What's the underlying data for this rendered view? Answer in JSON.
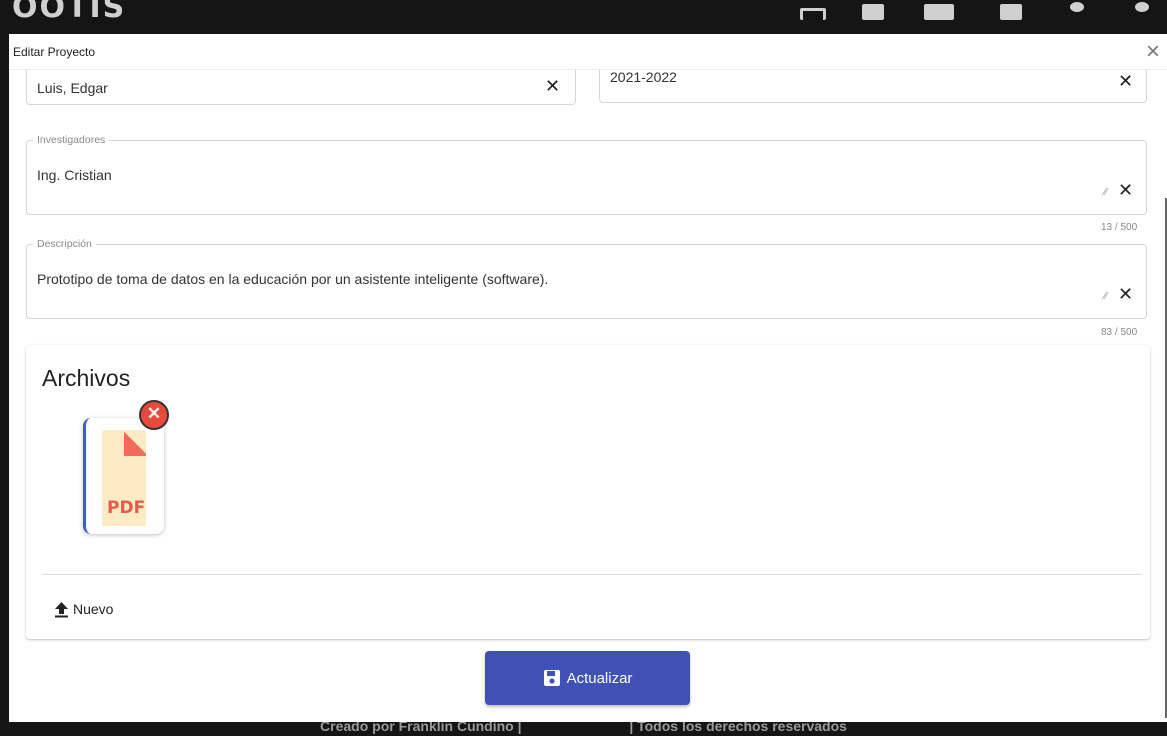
{
  "background": {
    "logo_text": "OOTIS",
    "footer_left": "Creado por Franklin Cundino |",
    "footer_right": "| Todos los derechos reservados"
  },
  "dialog": {
    "title": "Editar Proyecto",
    "close_icon": "close-icon"
  },
  "form": {
    "autores": {
      "value": "Luis, Edgar"
    },
    "periodo": {
      "value": "2021-2022"
    },
    "investigadores": {
      "label": "Investigadores",
      "value": "Ing. Cristian",
      "counter": "13 / 500"
    },
    "descripcion": {
      "label": "Descripción",
      "value": "Prototipo de toma de datos en la educación por un asistente inteligente (software).",
      "counter": "83 / 500"
    }
  },
  "files": {
    "title": "Archivos",
    "items": [
      {
        "type_label": "PDF",
        "icon": "pdf-file-icon"
      }
    ],
    "upload_label": "Nuevo"
  },
  "submit": {
    "label": "Actualizar",
    "icon": "save-icon"
  },
  "colors": {
    "primary": "#3f51b5",
    "danger": "#e64a3b",
    "pdf_page": "#fdebc5",
    "pdf_accent": "#f26a5a"
  }
}
